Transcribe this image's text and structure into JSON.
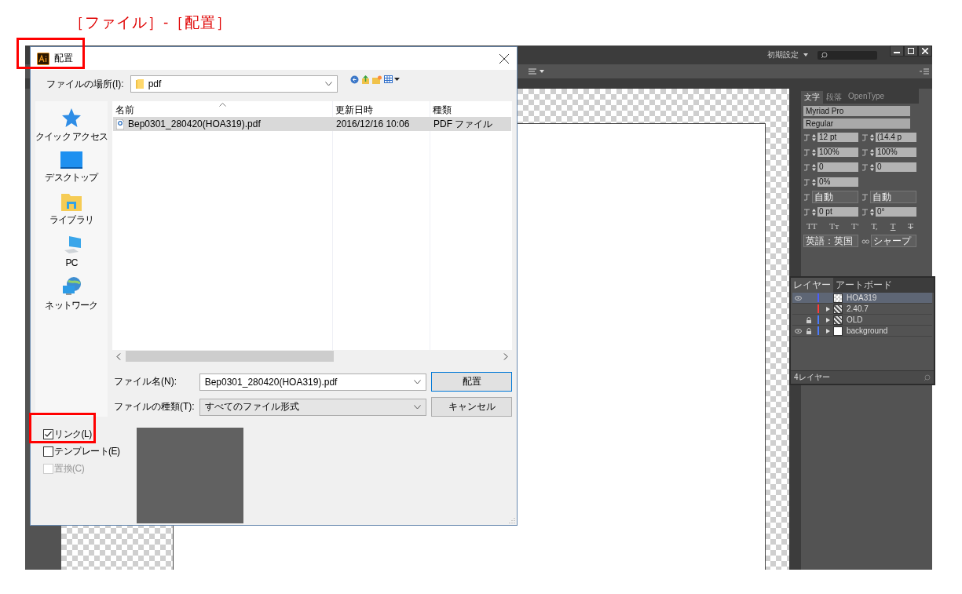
{
  "caption": "［ファイル］-［配置］",
  "app": {
    "workspace": "初期設定",
    "character_panel": {
      "tabs": [
        {
          "label": "文字",
          "selected": true
        },
        {
          "label": "段落",
          "selected": false
        },
        {
          "label": "OpenType",
          "selected": false
        }
      ],
      "font": "Myriad Pro",
      "style": "Regular",
      "rows": [
        [
          {
            "kind": "spin",
            "value": "12 pt"
          },
          {
            "kind": "spin",
            "value": "(14.4 p"
          }
        ],
        [
          {
            "kind": "spin",
            "value": "100%"
          },
          {
            "kind": "spin",
            "value": "100%"
          }
        ],
        [
          {
            "kind": "spin",
            "value": "0"
          },
          {
            "kind": "spin",
            "value": "0"
          }
        ],
        [
          {
            "kind": "spin",
            "value": "0%"
          }
        ],
        [
          {
            "kind": "menu",
            "value": "自動"
          },
          {
            "kind": "menu",
            "value": "自動"
          }
        ],
        [
          {
            "kind": "spin",
            "value": "0 pt"
          },
          {
            "kind": "spin",
            "value": "0°"
          }
        ]
      ],
      "type_styles": [
        {
          "kind": "plain",
          "label": "TT"
        },
        {
          "kind": "plain",
          "label": "Tт"
        },
        {
          "kind": "plain",
          "label": "T'"
        },
        {
          "kind": "plain",
          "label": "T,"
        },
        {
          "kind": "underline",
          "label": "T"
        },
        {
          "kind": "strike",
          "label": "T"
        }
      ],
      "language": "英語：英国",
      "antialias": "シャープ"
    },
    "layers_panel": {
      "tabs": [
        {
          "label": "レイヤー",
          "selected": true
        },
        {
          "label": "アートボード",
          "selected": false
        }
      ],
      "layers": [
        {
          "name": "HOA319",
          "visible": true,
          "locked": false,
          "expandable": false,
          "selected": true,
          "color": "#4c5cff",
          "kind": "checker"
        },
        {
          "name": "2.40.7",
          "visible": false,
          "locked": false,
          "expandable": true,
          "selected": false,
          "color": "#ff3a3a",
          "kind": "pattern"
        },
        {
          "name": "OLD",
          "visible": false,
          "locked": true,
          "expandable": true,
          "selected": false,
          "color": "#4c7cff",
          "kind": "pattern"
        },
        {
          "name": "background",
          "visible": true,
          "locked": true,
          "expandable": true,
          "selected": false,
          "color": "#4c7cff",
          "kind": "white"
        }
      ],
      "footer": "4レイヤー"
    }
  },
  "dialog": {
    "title": "配置",
    "location_label": "ファイルの場所(I):",
    "location": "pdf",
    "places": [
      {
        "kind": "star",
        "label": "クイック アクセス"
      },
      {
        "kind": "desktop",
        "label": "デスクトップ"
      },
      {
        "kind": "library",
        "label": "ライブラリ"
      },
      {
        "kind": "pc",
        "label": "PC"
      },
      {
        "kind": "network",
        "label": "ネットワーク"
      }
    ],
    "columns": [
      "名前",
      "更新日時",
      "種類"
    ],
    "rows": [
      {
        "name": "Bep0301_280420(HOA319).pdf",
        "date": "2016/12/16 10:06",
        "type": "PDF ファイル",
        "selected": true
      }
    ],
    "filename_label": "ファイル名(N):",
    "filename": "Bep0301_280420(HOA319).pdf",
    "filetype_label": "ファイルの種類(T):",
    "filetype": "すべてのファイル形式",
    "buttons": [
      "配置",
      "キャンセル"
    ],
    "options": [
      {
        "label": "リンク(L)",
        "checked": true,
        "disabled": false
      },
      {
        "label": "テンプレート(E)",
        "checked": false,
        "disabled": false
      },
      {
        "label": "置換(C)",
        "checked": false,
        "disabled": true
      }
    ]
  }
}
